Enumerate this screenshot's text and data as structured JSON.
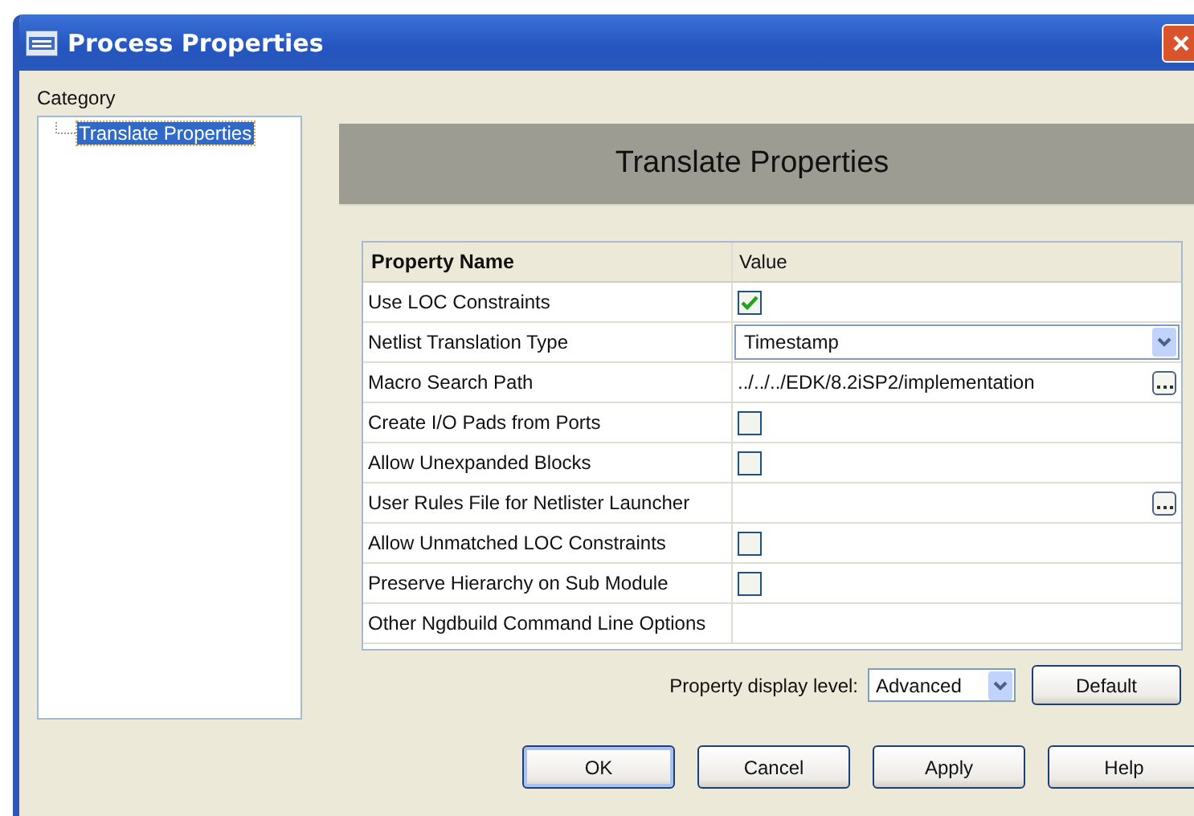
{
  "window": {
    "title": "Process Properties"
  },
  "category": {
    "label": "Category",
    "items": [
      {
        "label": "Translate Properties",
        "selected": true
      }
    ]
  },
  "panel_title": "Translate Properties",
  "table": {
    "columns": [
      "Property Name",
      "Value"
    ],
    "rows": [
      {
        "name": "Use LOC Constraints",
        "kind": "checkbox",
        "checked": true
      },
      {
        "name": "Netlist Translation Type",
        "kind": "dropdown",
        "value": "Timestamp"
      },
      {
        "name": "Macro Search Path",
        "kind": "browse",
        "value": "../../../EDK/8.2iSP2/implementation"
      },
      {
        "name": "Create I/O Pads from Ports",
        "kind": "checkbox",
        "checked": false
      },
      {
        "name": "Allow Unexpanded Blocks",
        "kind": "checkbox",
        "checked": false
      },
      {
        "name": "User Rules File for Netlister Launcher",
        "kind": "browse"
      },
      {
        "name": "Allow Unmatched LOC Constraints",
        "kind": "checkbox",
        "checked": false
      },
      {
        "name": "Preserve Hierarchy on Sub Module",
        "kind": "checkbox",
        "checked": false
      },
      {
        "name": "Other Ngdbuild Command Line Options",
        "kind": "text"
      }
    ]
  },
  "display_level": {
    "label": "Property display level:",
    "value": "Advanced",
    "button": "Default"
  },
  "buttons": [
    {
      "label": "OK",
      "default": true
    },
    {
      "label": "Cancel",
      "default": false
    },
    {
      "label": "Apply",
      "default": false
    },
    {
      "label": "Help",
      "default": false
    }
  ]
}
